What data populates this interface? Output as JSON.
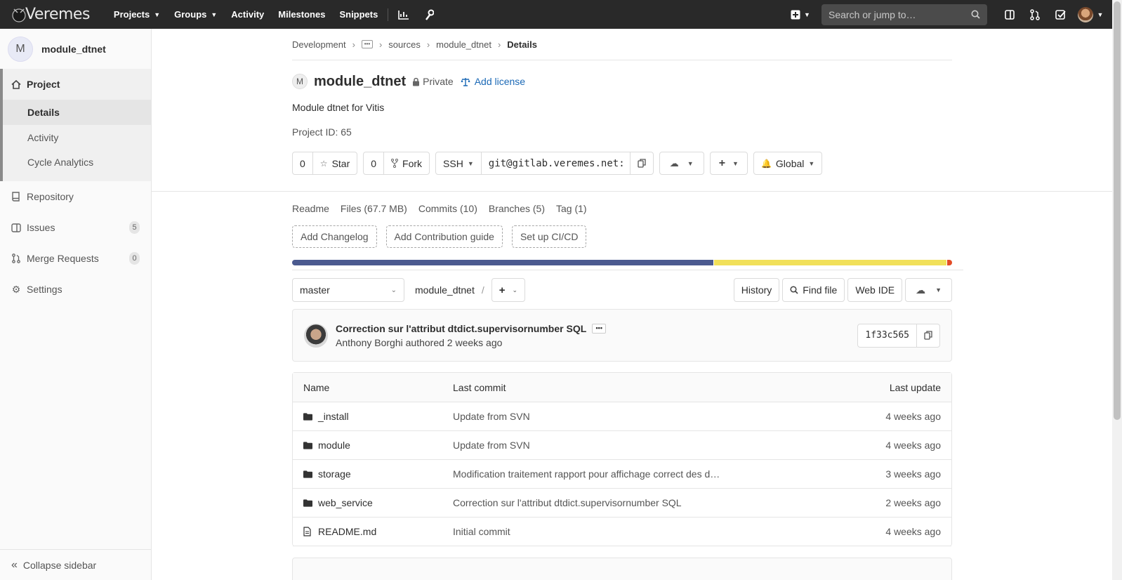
{
  "navbar": {
    "brand": "Veremes",
    "links": [
      {
        "label": "Projects",
        "dropdown": true
      },
      {
        "label": "Groups",
        "dropdown": true
      },
      {
        "label": "Activity",
        "dropdown": false
      },
      {
        "label": "Milestones",
        "dropdown": false
      },
      {
        "label": "Snippets",
        "dropdown": false
      }
    ],
    "search_placeholder": "Search or jump to…"
  },
  "sidebar": {
    "project_initial": "M",
    "project_name": "module_dtnet",
    "project_label": "Project",
    "project_subitems": [
      "Details",
      "Activity",
      "Cycle Analytics"
    ],
    "items": [
      {
        "label": "Repository",
        "icon": "book-icon"
      },
      {
        "label": "Issues",
        "icon": "issues-icon",
        "count": "5"
      },
      {
        "label": "Merge Requests",
        "icon": "merge-request-icon",
        "count": "0"
      },
      {
        "label": "Settings",
        "icon": "gear-icon"
      }
    ],
    "collapse_label": "Collapse sidebar"
  },
  "breadcrumb": {
    "items": [
      "Development",
      "sources",
      "module_dtnet"
    ],
    "current": "Details"
  },
  "project": {
    "initial": "M",
    "name": "module_dtnet",
    "visibility": "Private",
    "license_link": "Add license",
    "description": "Module dtnet for Vitis",
    "project_id": "Project ID: 65",
    "star_count": "0",
    "star_label": "Star",
    "fork_count": "0",
    "fork_label": "Fork",
    "clone_protocol": "SSH",
    "clone_url": "git@gitlab.veremes.net:",
    "notification": "Global"
  },
  "stats": [
    "Readme",
    "Files (67.7 MB)",
    "Commits (10)",
    "Branches (5)",
    "Tag (1)"
  ],
  "quick_actions": [
    "Add Changelog",
    "Add Contribution guide",
    "Set up CI/CD"
  ],
  "languages": [
    {
      "percent": 64.0,
      "color": "#4b5a8f"
    },
    {
      "percent": 35.2,
      "color": "#f1e05a"
    },
    {
      "percent": 0.8,
      "color": "#e34c26"
    }
  ],
  "tree": {
    "branch": "master",
    "path": "module_dtnet",
    "history": "History",
    "find_file": "Find file",
    "web_ide": "Web IDE"
  },
  "last_commit": {
    "title": "Correction sur l'attribut dtdict.supervisornumber SQL",
    "meta": "Anthony Borghi authored 2 weeks ago",
    "sha": "1f33c565"
  },
  "files": {
    "headers": [
      "Name",
      "Last commit",
      "Last update"
    ],
    "rows": [
      {
        "name": "_install",
        "type": "folder",
        "commit": "Update from SVN",
        "date": "4 weeks ago"
      },
      {
        "name": "module",
        "type": "folder",
        "commit": "Update from SVN",
        "date": "4 weeks ago"
      },
      {
        "name": "storage",
        "type": "folder",
        "commit": "Modification traitement rapport pour affichage correct des d…",
        "date": "3 weeks ago"
      },
      {
        "name": "web_service",
        "type": "folder",
        "commit": "Correction sur l'attribut dtdict.supervisornumber SQL",
        "date": "2 weeks ago"
      },
      {
        "name": "README.md",
        "type": "file",
        "commit": "Initial commit",
        "date": "4 weeks ago"
      }
    ]
  }
}
